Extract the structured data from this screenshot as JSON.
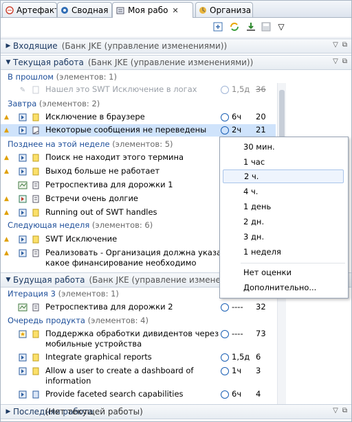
{
  "tabs": [
    {
      "label": "Артефакт",
      "icon": "artifact-icon"
    },
    {
      "label": "Сводная",
      "icon": "summary-icon"
    },
    {
      "label": "Моя рабо",
      "icon": "my-work-icon",
      "active": true
    },
    {
      "label": "Организа",
      "icon": "organizer-icon"
    }
  ],
  "toolbar": {
    "icons": [
      "new-item-icon",
      "sync-icon",
      "download-icon",
      "save-icon",
      "view-menu-icon"
    ]
  },
  "sections": {
    "inbox": {
      "title": "Входящие",
      "sub": "(Банк JKE (управление изменениями))"
    },
    "current": {
      "title": "Текущая работа",
      "sub": "(Банк JKE (управление изменениями))"
    },
    "future": {
      "title": "Будущая работа",
      "sub": "(Банк JKE (управление изменениями"
    },
    "recent": {
      "title": "Последняя работа",
      "right": "(Нет текущей работы)"
    }
  },
  "groups": {
    "past": {
      "name": "В прошлом",
      "count": "(элементов: 1)"
    },
    "tomorrow": {
      "name": "Завтра",
      "count": "(элементов: 2)"
    },
    "late_week": {
      "name": "Позднее на этой неделе",
      "count": "(элементов: 5)"
    },
    "next_week": {
      "name": "Следующая неделя",
      "count": "(элементов: 6)"
    },
    "iteration": {
      "name": "Итерация 3",
      "count": "(элементов: 1)"
    },
    "backlog": {
      "name": "Очередь продукта",
      "count": "(элементов: 4)"
    }
  },
  "rows": {
    "r1": {
      "text": "Нашел это SWT Исключение в логах",
      "est": "1,5д",
      "num": "36"
    },
    "r2": {
      "text": "Исключение в браузере",
      "est": "6ч",
      "num": "20"
    },
    "r3": {
      "text": "Некоторые сообщения не переведены",
      "est": "2ч",
      "num": "21"
    },
    "r4": {
      "text": "Поиск не находит этого термина"
    },
    "r5": {
      "text": "Выход больше не работает"
    },
    "r6": {
      "text": "Ретроспектива для дорожки 1"
    },
    "r7": {
      "text": "Встречи очень долгие"
    },
    "r8": {
      "text": "Running out of SWT handles"
    },
    "r9": {
      "text": "SWT Исключение"
    },
    "r10": {
      "line1": "Реализовать - Организация должна указать",
      "line2": "какое финансирование необходимо"
    },
    "r11": {
      "text": "Ретроспектива для дорожки 2",
      "est": "----",
      "num": "32"
    },
    "r12": {
      "line1": "Поддержка обработки дивидентов через",
      "line2": "мобильные устройства",
      "est": "----",
      "num": "73"
    },
    "r13": {
      "text": "Integrate graphical reports",
      "est": "1,5д",
      "num": "6"
    },
    "r14": {
      "line1": "Allow a user to create a dashboard of",
      "line2": "information",
      "est": "1ч",
      "num": "3"
    },
    "r15": {
      "text": "Provide faceted search capabilities",
      "est": "6ч",
      "num": "4"
    }
  },
  "menu": {
    "items": [
      "30 мин.",
      "1 час",
      "2 ч.",
      "4 ч.",
      "1 день",
      "2 дн.",
      "3 дн.",
      "1 неделя"
    ],
    "highlighted": "2 ч.",
    "extra": [
      "Нет оценки",
      "Дополнительно..."
    ]
  },
  "colors": {
    "group_heading": "#1e4f9a",
    "selection": "#cfe3fb",
    "warning": "#e0a000"
  }
}
